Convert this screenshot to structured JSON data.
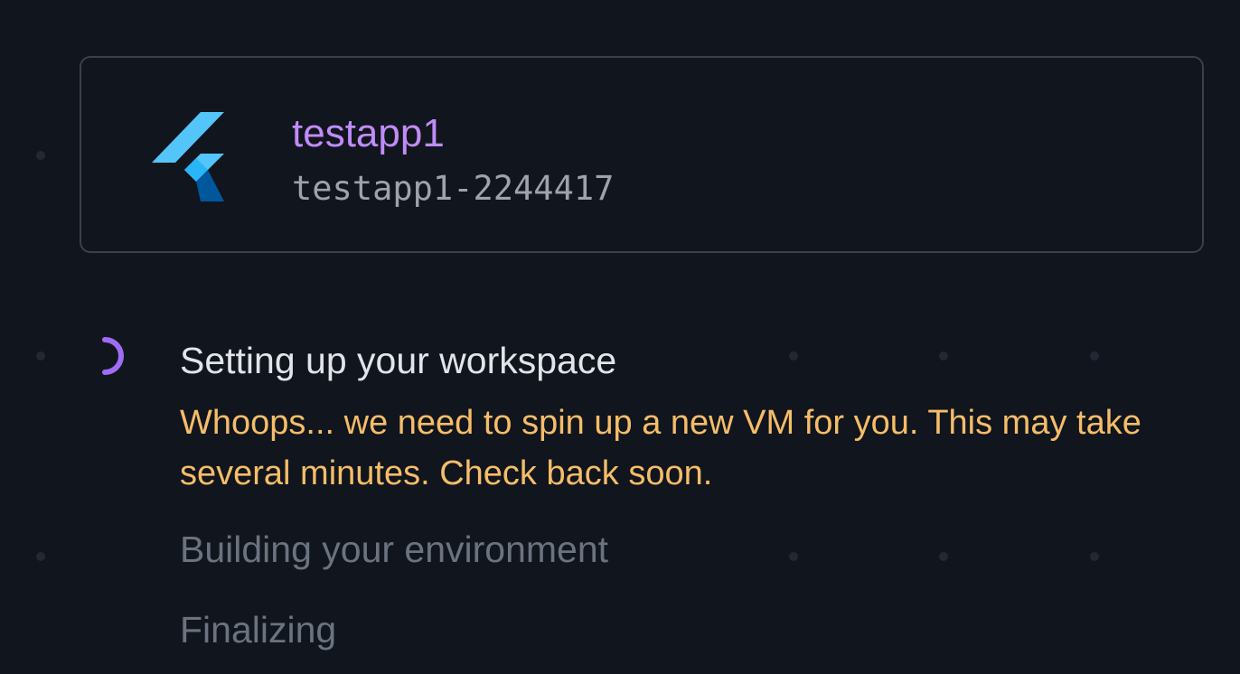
{
  "project": {
    "name": "testapp1",
    "id": "testapp1-2244417",
    "logo_icon": "flutter-logo-icon"
  },
  "steps": [
    {
      "label": "Setting up your workspace",
      "status": "in-progress",
      "message": "Whoops... we need to spin up a new VM for you. This may take several minutes. Check back soon."
    },
    {
      "label": "Building your environment",
      "status": "pending"
    },
    {
      "label": "Finalizing",
      "status": "pending"
    }
  ],
  "colors": {
    "background": "#11151d",
    "project_name": "#c08cf8",
    "warning": "#f5bd69",
    "spinner": "#9f6df3"
  }
}
